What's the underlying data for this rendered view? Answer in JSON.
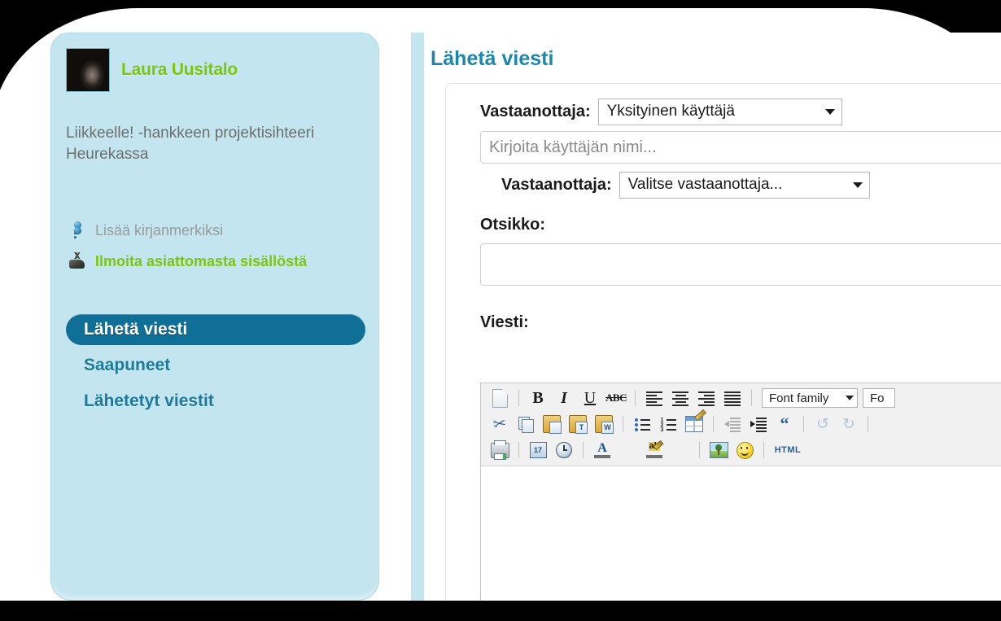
{
  "sidebar": {
    "user_name": "Laura Uusitalo",
    "avatar_icon": "user-photo",
    "bio": "Liikkeelle! -hankkeen projektisihteeri Heurekassa",
    "actions": [
      {
        "label": "Lisää kirjanmerkiksi",
        "icon": "pin-icon",
        "color": "#9a9a9a"
      },
      {
        "label": "Ilmoita asiattomasta sisällöstä",
        "icon": "report-icon",
        "color": "#7ac70c"
      }
    ],
    "nav": [
      {
        "label": "Lähetä viesti",
        "active": true
      },
      {
        "label": "Saapuneet",
        "active": false
      },
      {
        "label": "Lähetetyt viestit",
        "active": false
      }
    ]
  },
  "main": {
    "title": "Lähetä viesti",
    "recipient_type": {
      "label": "Vastaanottaja:",
      "value": "Yksityinen käyttäjä",
      "caret_icon": "chevron-down-icon"
    },
    "recipient_name": {
      "placeholder": "Kirjoita käyttäjän nimi...",
      "value": ""
    },
    "recipient_select": {
      "label": "Vastaanottaja:",
      "value": "Valitse vastaanottaja...",
      "caret_icon": "chevron-down-icon"
    },
    "subject": {
      "label": "Otsikko:",
      "value": "",
      "placeholder": ""
    },
    "message": {
      "label": "Viesti:",
      "body": ""
    }
  },
  "editor": {
    "row1": [
      {
        "name": "new-document-icon",
        "glyph": "doc"
      },
      {
        "name": "separator",
        "glyph": "sep"
      },
      {
        "name": "bold-icon",
        "glyph": "bold",
        "text": "B"
      },
      {
        "name": "italic-icon",
        "glyph": "ital",
        "text": "I"
      },
      {
        "name": "underline-icon",
        "glyph": "und",
        "text": "U"
      },
      {
        "name": "strikethrough-icon",
        "glyph": "strike",
        "text": "ABC"
      },
      {
        "name": "separator",
        "glyph": "sep"
      },
      {
        "name": "align-left-icon",
        "glyph": "al-l"
      },
      {
        "name": "align-center-icon",
        "glyph": "al-c"
      },
      {
        "name": "align-right-icon",
        "glyph": "al-r"
      },
      {
        "name": "align-justify-icon",
        "glyph": "al-j"
      },
      {
        "name": "separator",
        "glyph": "sep"
      }
    ],
    "font_family_label": "Font family",
    "font_size_label": "Fo",
    "row2": [
      {
        "name": "cut-icon",
        "glyph": "scissors",
        "text": "✂"
      },
      {
        "name": "copy-icon",
        "glyph": "copy"
      },
      {
        "name": "paste-icon",
        "glyph": "paste",
        "text": ""
      },
      {
        "name": "paste-as-text-icon",
        "glyph": "paste",
        "text": "T"
      },
      {
        "name": "paste-from-word-icon",
        "glyph": "paste",
        "text": "W"
      },
      {
        "name": "separator",
        "glyph": "sep"
      },
      {
        "name": "bullet-list-icon",
        "glyph": "ul"
      },
      {
        "name": "numbered-list-icon",
        "glyph": "ol"
      },
      {
        "name": "table-icon",
        "glyph": "table"
      },
      {
        "name": "separator",
        "glyph": "sep"
      },
      {
        "name": "outdent-icon",
        "glyph": "ind-out",
        "dim": true
      },
      {
        "name": "indent-icon",
        "glyph": "ind-in"
      },
      {
        "name": "blockquote-icon",
        "glyph": "quote",
        "text": "“"
      },
      {
        "name": "separator",
        "glyph": "sep"
      },
      {
        "name": "undo-icon",
        "glyph": "undo",
        "text": "↺",
        "dim": true
      },
      {
        "name": "redo-icon",
        "glyph": "redo",
        "text": "↻",
        "dim": true
      },
      {
        "name": "separator",
        "glyph": "sep"
      }
    ],
    "row3": [
      {
        "name": "print-icon",
        "glyph": "print"
      },
      {
        "name": "separator",
        "glyph": "sep"
      },
      {
        "name": "insert-date-icon",
        "glyph": "date",
        "text": "17"
      },
      {
        "name": "insert-time-icon",
        "glyph": "clock"
      },
      {
        "name": "separator",
        "glyph": "sep"
      },
      {
        "name": "text-color-icon",
        "glyph": "color",
        "text": "A"
      },
      {
        "name": "text-color-dropdown-icon",
        "glyph": "caret"
      },
      {
        "name": "highlight-color-icon",
        "glyph": "hl",
        "text": "ab"
      },
      {
        "name": "highlight-color-dropdown-icon",
        "glyph": "caret"
      },
      {
        "name": "separator",
        "glyph": "sep"
      },
      {
        "name": "insert-image-icon",
        "glyph": "img"
      },
      {
        "name": "emoticon-icon",
        "glyph": "smile"
      },
      {
        "name": "separator",
        "glyph": "sep"
      },
      {
        "name": "html-source-icon",
        "glyph": "html",
        "text": "HTML"
      }
    ]
  },
  "colors": {
    "sidebar_bg": "#c3e5ef",
    "accent_green": "#7ac70c",
    "accent_teal": "#1c87ad",
    "nav_active_bg": "#0f6f96",
    "page_bg": "#000000"
  }
}
